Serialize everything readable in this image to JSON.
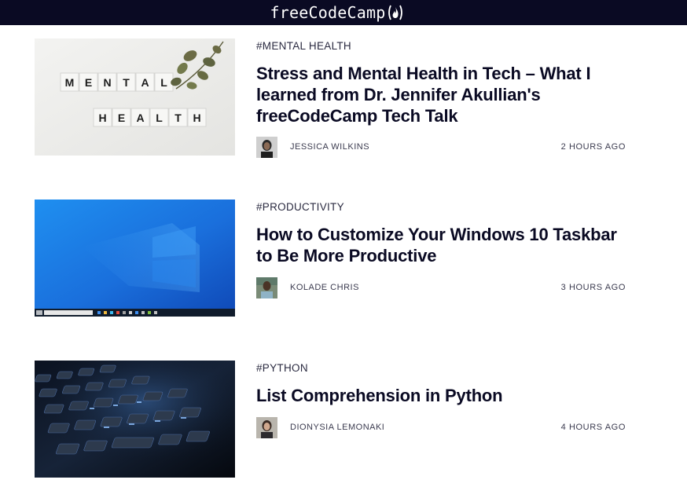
{
  "header": {
    "logo_text": "freeCodeCamp",
    "logo_icon": "fire-icon",
    "background": "#0a0a23"
  },
  "posts": [
    {
      "tag": "#MENTAL HEALTH",
      "title": "Stress and Mental Health in Tech – What I learned from Dr. Jennifer Akullian's freeCodeCamp Tech Talk",
      "author": "JESSICA WILKINS",
      "time": "2 HOURS AGO",
      "image_tiles": [
        "M",
        "E",
        "N",
        "T",
        "A",
        "L",
        "H",
        "E",
        "A",
        "L",
        "T",
        "H"
      ]
    },
    {
      "tag": "#PRODUCTIVITY",
      "title": "How to Customize Your Windows 10 Taskbar to Be More Productive",
      "author": "KOLADE CHRIS",
      "time": "3 HOURS AGO"
    },
    {
      "tag": "#PYTHON",
      "title": "List Comprehension in Python",
      "author": "DIONYSIA LEMONAKI",
      "time": "4 HOURS AGO"
    }
  ]
}
